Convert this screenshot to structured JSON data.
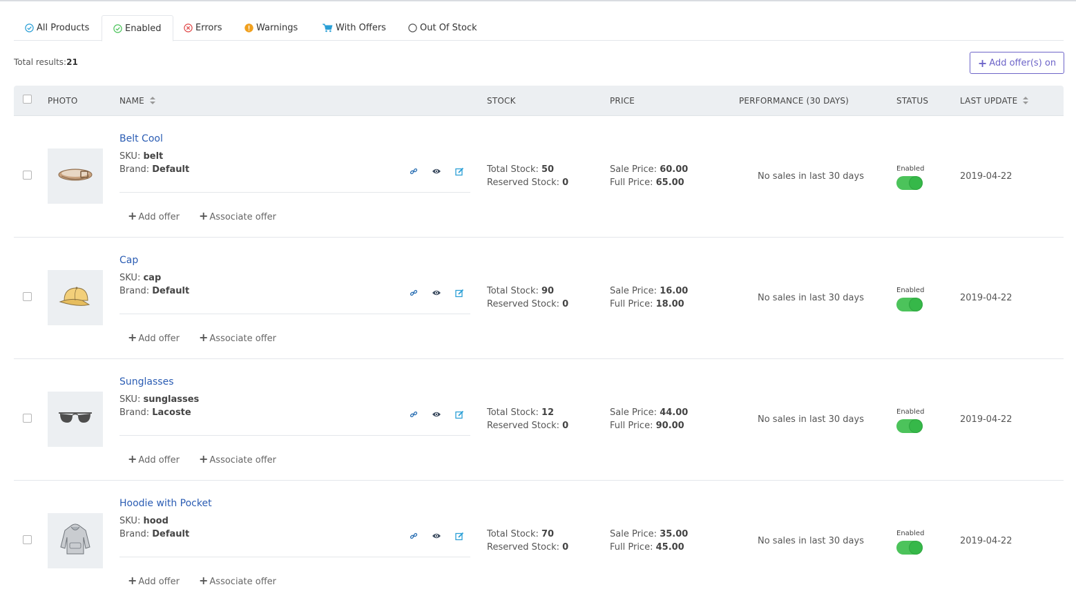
{
  "tabs": [
    {
      "label": "All Products",
      "icon": "check-circle-icon",
      "color": "#2a9fd6"
    },
    {
      "label": "Enabled",
      "icon": "check-circle-icon",
      "color": "#4cc35b"
    },
    {
      "label": "Errors",
      "icon": "x-circle-icon",
      "color": "#e04b4b"
    },
    {
      "label": "Warnings",
      "icon": "warning-icon",
      "color": "#f0a01e"
    },
    {
      "label": "With Offers",
      "icon": "cart-icon",
      "color": "#2a9fd6"
    },
    {
      "label": "Out Of Stock",
      "icon": "circle-icon",
      "color": "#555555"
    }
  ],
  "active_tab": "Enabled",
  "summary": {
    "label": "Total results:",
    "count": "21"
  },
  "add_offers_button": "Add offer(s) on",
  "columns": {
    "photo": "PHOTO",
    "name": "NAME",
    "stock": "STOCK",
    "price": "PRICE",
    "performance": "PERFORMANCE (30 DAYS)",
    "status": "STATUS",
    "last_update": "LAST UPDATE"
  },
  "labels": {
    "sku": "SKU:",
    "brand": "Brand:",
    "total_stock": "Total Stock:",
    "reserved_stock": "Reserved Stock:",
    "sale_price": "Sale Price:",
    "full_price": "Full Price:",
    "add_offer": "Add offer",
    "associate_offer": "Associate offer"
  },
  "products": [
    {
      "name": "Belt Cool",
      "sku": "belt",
      "brand": "Default",
      "total_stock": "50",
      "reserved_stock": "0",
      "sale_price": "60.00",
      "full_price": "65.00",
      "performance": "No sales in last 30 days",
      "status": "Enabled",
      "last_update": "2019-04-22",
      "image": "belt-image"
    },
    {
      "name": "Cap",
      "sku": "cap",
      "brand": "Default",
      "total_stock": "90",
      "reserved_stock": "0",
      "sale_price": "16.00",
      "full_price": "18.00",
      "performance": "No sales in last 30 days",
      "status": "Enabled",
      "last_update": "2019-04-22",
      "image": "cap-image"
    },
    {
      "name": "Sunglasses",
      "sku": "sunglasses",
      "brand": "Lacoste",
      "total_stock": "12",
      "reserved_stock": "0",
      "sale_price": "44.00",
      "full_price": "90.00",
      "performance": "No sales in last 30 days",
      "status": "Enabled",
      "last_update": "2019-04-22",
      "image": "sunglasses-image"
    },
    {
      "name": "Hoodie with Pocket",
      "sku": "hood",
      "brand": "Default",
      "total_stock": "70",
      "reserved_stock": "0",
      "sale_price": "35.00",
      "full_price": "45.00",
      "performance": "No sales in last 30 days",
      "status": "Enabled",
      "last_update": "2019-04-22",
      "image": "hoodie-image"
    }
  ],
  "colors": {
    "accent": "#6c63c8",
    "link": "#2a5cb3",
    "toggle_on": "#4cc35b",
    "action_icon": "#2a9fd6"
  }
}
